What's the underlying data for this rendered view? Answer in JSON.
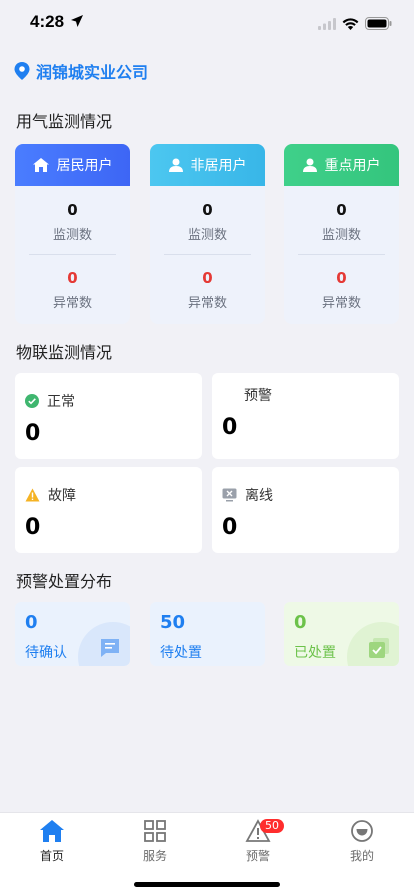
{
  "status": {
    "time": "4:28"
  },
  "company": {
    "name": "润锦城实业公司"
  },
  "gas_section": {
    "title": "用气监测情况",
    "cards": [
      {
        "title": "居民用户",
        "icon": "home-icon",
        "color_from": "#4a7dff",
        "color_to": "#3d66f5",
        "monitor_value": "0",
        "monitor_label": "监测数",
        "abnormal_value": "0",
        "abnormal_label": "异常数"
      },
      {
        "title": "非居用户",
        "icon": "user-icon",
        "color_from": "#4cc7f0",
        "color_to": "#38b6e8",
        "monitor_value": "0",
        "monitor_label": "监测数",
        "abnormal_value": "0",
        "abnormal_label": "异常数"
      },
      {
        "title": "重点用户",
        "icon": "user-icon",
        "color_from": "#3fd08a",
        "color_to": "#34c57d",
        "monitor_value": "0",
        "monitor_label": "监测数",
        "abnormal_value": "0",
        "abnormal_label": "异常数"
      }
    ]
  },
  "iot_section": {
    "title": "物联监测情况",
    "cards": [
      {
        "label": "正常",
        "value": "0",
        "icon": "check-circle-icon"
      },
      {
        "label": "预警",
        "value": "0",
        "icon": ""
      },
      {
        "label": "故障",
        "value": "0",
        "icon": "warning-icon"
      },
      {
        "label": "离线",
        "value": "0",
        "icon": "offline-icon"
      }
    ]
  },
  "warning_section": {
    "title": "预警处置分布",
    "cards": [
      {
        "value": "0",
        "label": "待确认",
        "color": "#1f7ff0",
        "bg": "#eaf2fd",
        "icon": "chat-icon"
      },
      {
        "value": "50",
        "label": "待处置",
        "color": "#1f7ff0",
        "bg": "#eaf2fd",
        "icon": ""
      },
      {
        "value": "0",
        "label": "已处置",
        "color": "#6cc24a",
        "bg": "#eef9e6",
        "icon": "check-box-icon"
      }
    ]
  },
  "tabbar": {
    "items": [
      {
        "label": "首页",
        "icon": "home-icon",
        "active": true
      },
      {
        "label": "服务",
        "icon": "grid-icon",
        "active": false
      },
      {
        "label": "预警",
        "icon": "alert-triangle-icon",
        "active": false,
        "badge": "50"
      },
      {
        "label": "我的",
        "icon": "smile-icon",
        "active": false
      }
    ]
  }
}
